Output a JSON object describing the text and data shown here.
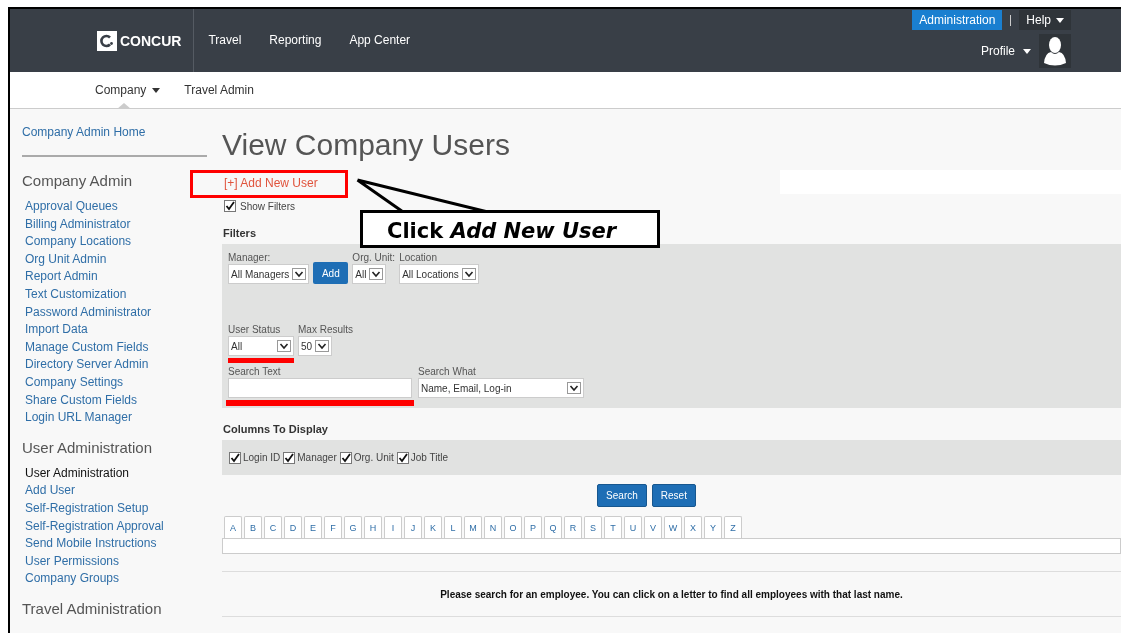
{
  "header": {
    "logo": "CONCUR",
    "nav": [
      "Travel",
      "Reporting",
      "App Center"
    ],
    "links": [
      {
        "label": "Administration",
        "selected": true,
        "dropdown": false
      },
      {
        "label": "Help",
        "selected": false,
        "dropdown": true
      }
    ],
    "profile": {
      "label": "Profile"
    }
  },
  "subnav": [
    {
      "label": "Company",
      "selected": true,
      "dropdown": true
    },
    {
      "label": "Travel Admin",
      "selected": false,
      "dropdown": false
    }
  ],
  "sidebar": {
    "home": "Company Admin Home",
    "sections": [
      {
        "title": "Company Admin",
        "items": [
          {
            "label": "Approval Queues",
            "selected": false
          },
          {
            "label": "Billing Administrator",
            "selected": false
          },
          {
            "label": "Company Locations",
            "selected": false
          },
          {
            "label": "Org Unit Admin",
            "selected": false
          },
          {
            "label": "Report Admin",
            "selected": false
          },
          {
            "label": "Text Customization",
            "selected": false
          },
          {
            "label": "Password Administrator",
            "selected": false
          },
          {
            "label": "Import Data",
            "selected": false
          },
          {
            "label": "Manage Custom Fields",
            "selected": false
          },
          {
            "label": "Directory Server Admin",
            "selected": false
          },
          {
            "label": "Company Settings",
            "selected": false
          },
          {
            "label": "Share Custom Fields",
            "selected": false
          },
          {
            "label": "Login URL Manager",
            "selected": false
          }
        ]
      },
      {
        "title": "User Administration",
        "items": [
          {
            "label": "User Administration",
            "selected": true
          },
          {
            "label": "Add User",
            "selected": false
          },
          {
            "label": "Self-Registration Setup",
            "selected": false
          },
          {
            "label": "Self-Registration Approval",
            "selected": false
          },
          {
            "label": "Send Mobile Instructions",
            "selected": false
          },
          {
            "label": "User Permissions",
            "selected": false
          },
          {
            "label": "Company Groups",
            "selected": false
          }
        ]
      },
      {
        "title": "Travel Administration"
      }
    ]
  },
  "main": {
    "title": "View Company Users",
    "add_link": "[+] Add New User",
    "show_filters": {
      "label": "Show Filters",
      "checked": true
    },
    "filters": {
      "heading": "Filters",
      "manager": {
        "label": "Manager:",
        "value": "All Managers"
      },
      "add_button": "Add",
      "org_unit": {
        "label": "Org. Unit:",
        "value": "All"
      },
      "location": {
        "label": "Location",
        "value": "All Locations"
      },
      "user_status": {
        "label": "User Status",
        "value": "All"
      },
      "max_results": {
        "label": "Max Results",
        "value": "50"
      },
      "search_text": {
        "label": "Search Text"
      },
      "search_what": {
        "label": "Search What",
        "value": "Name, Email, Log-in"
      }
    },
    "columns": {
      "heading": "Columns To Display",
      "items": [
        {
          "label": "Login ID",
          "checked": true
        },
        {
          "label": "Manager",
          "checked": true
        },
        {
          "label": "Org. Unit",
          "checked": true
        },
        {
          "label": "Job Title",
          "checked": true
        }
      ]
    },
    "buttons": [
      "Search",
      "Reset"
    ],
    "letters": [
      "A",
      "B",
      "C",
      "D",
      "E",
      "F",
      "G",
      "H",
      "I",
      "J",
      "K",
      "L",
      "M",
      "N",
      "O",
      "P",
      "Q",
      "R",
      "S",
      "T",
      "U",
      "V",
      "W",
      "X",
      "Y",
      "Z"
    ],
    "message": "Please search for an employee. You can click on a letter to find all employees with that last name."
  },
  "annotation": {
    "callout": "Click *Add New User*"
  }
}
